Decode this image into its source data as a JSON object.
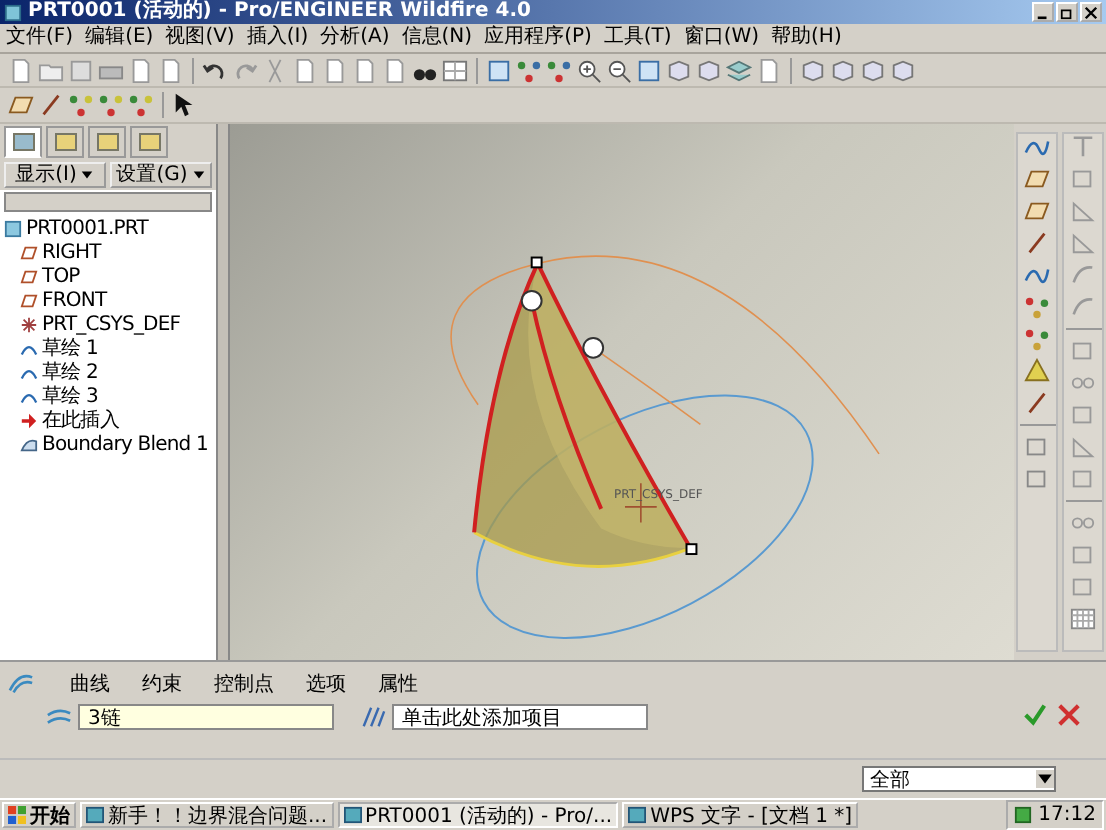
{
  "window": {
    "title": "PRT0001 (活动的) - Pro/ENGINEER Wildfire 4.0"
  },
  "menu": [
    "文件(F)",
    "编辑(E)",
    "视图(V)",
    "插入(I)",
    "分析(A)",
    "信息(N)",
    "应用程序(P)",
    "工具(T)",
    "窗口(W)",
    "帮助(H)"
  ],
  "navigator_tabs": [
    {
      "selected": true
    },
    {
      "selected": false
    },
    {
      "selected": false
    },
    {
      "selected": false
    }
  ],
  "tree_buttons": [
    "显示(I)",
    "设置(G)"
  ],
  "model_tree": {
    "label": "PRT0001.PRT",
    "children": [
      {
        "label": "RIGHT",
        "kind": "plane"
      },
      {
        "label": "TOP",
        "kind": "plane"
      },
      {
        "label": "FRONT",
        "kind": "plane"
      },
      {
        "label": "PRT_CSYS_DEF",
        "kind": "csys"
      },
      {
        "label": "草绘 1",
        "kind": "sketch"
      },
      {
        "label": "草绘 2",
        "kind": "sketch"
      },
      {
        "label": "草绘 3",
        "kind": "sketch"
      },
      {
        "label": "在此插入",
        "kind": "insert"
      },
      {
        "label": "Boundary Blend 1",
        "kind": "blend"
      }
    ]
  },
  "graphics": {
    "csys_label": "PRT_CSYS_DEF"
  },
  "dashboard": {
    "tabs": [
      "曲线",
      "约束",
      "控制点",
      "选项",
      "属性"
    ],
    "fields": [
      {
        "value": "3链"
      },
      {
        "value": "单击此处添加项目"
      }
    ]
  },
  "filter": {
    "value": "全部"
  },
  "taskbar": {
    "start": "开始",
    "tasks": [
      {
        "label": "新手！！边界混合问题...",
        "selected": false
      },
      {
        "label": "PRT0001 (活动的) - Pro/...",
        "selected": true
      },
      {
        "label": "WPS 文字 - [文档 1 *]",
        "selected": false
      }
    ],
    "clock": "17:12"
  }
}
